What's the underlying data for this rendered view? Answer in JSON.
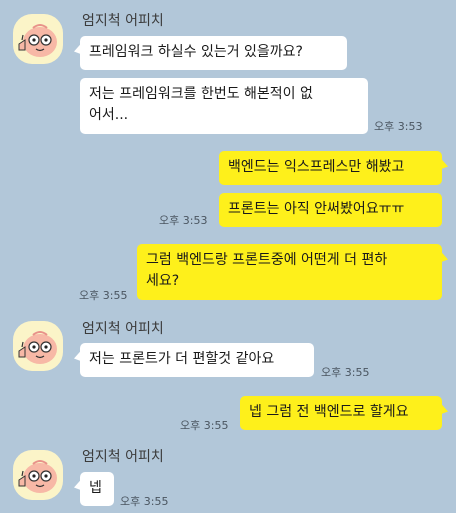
{
  "chat": {
    "messages": [
      {
        "side": "left",
        "sender": "엄지척 어피치",
        "text": "프레임워크 하실수 있는거 있을까요?",
        "time": ""
      },
      {
        "side": "left",
        "text": "저는 프레임워크를 한번도 해본적이 없\n어서...",
        "time": "오후 3:53"
      },
      {
        "side": "right",
        "text": "백엔드는 익스프레스만 해봤고",
        "time": ""
      },
      {
        "side": "right",
        "text": "프론트는 아직 안써봤어요ㅠㅠ",
        "time": "오후 3:53"
      },
      {
        "side": "right",
        "text": "그럼 백엔드랑 프론트중에 어떤게 더 편하\n세요?",
        "time": "오후 3:55"
      },
      {
        "side": "left",
        "sender": "엄지척 어피치",
        "text": "저는 프론트가 더 편할것 같아요",
        "time": "오후 3:55"
      },
      {
        "side": "right",
        "text": "넵 그럼 전 백엔드로 할게요",
        "time": "오후 3:55"
      },
      {
        "side": "left",
        "sender": "엄지척 어피치",
        "text": "넵",
        "time": "오후 3:55"
      }
    ]
  },
  "colors": {
    "background": "#b2c7d9",
    "incoming_bubble": "#ffffff",
    "outgoing_bubble": "#fef01b",
    "avatar_bg": "#fbf4c8",
    "avatar_face": "#f7b8a6"
  },
  "icons": {
    "avatar": "apeach-thumbs-up-icon"
  }
}
